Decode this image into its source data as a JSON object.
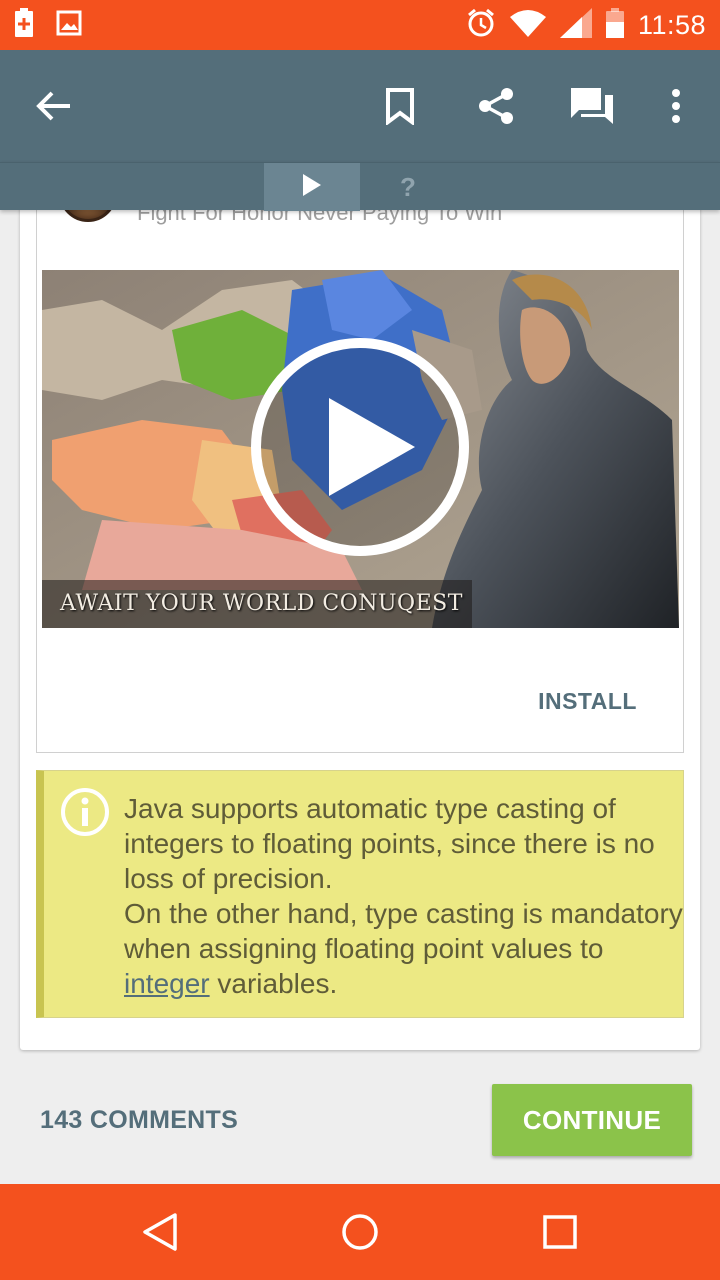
{
  "status_bar": {
    "time": "11:58",
    "icons": [
      "battery-charging-icon",
      "image-notification-icon",
      "alarm-icon",
      "wifi-icon",
      "signal-icon",
      "battery-icon"
    ],
    "color": "#f4511e"
  },
  "app_bar": {
    "icons": [
      "back-arrow-icon",
      "bookmark-icon",
      "share-icon",
      "comments-icon",
      "overflow-menu-icon"
    ],
    "color": "#546e7a"
  },
  "tabs": [
    {
      "icon": "play-icon",
      "active": true
    },
    {
      "label": "?",
      "active": false
    }
  ],
  "ad": {
    "tagline": "Fight For Honor Never Paying To Win",
    "video_caption": "AWAIT YOUR WORLD CONUQEST",
    "install_label": "INSTALL"
  },
  "tip": {
    "line1": "Java supports automatic type casting of integers to floating points, since there is no loss of precision.",
    "line2_prefix": "On the other hand, type casting is mandatory when assigning floating point values to ",
    "line2_link": "integer",
    "line2_suffix": " variables.",
    "background": "#ece984"
  },
  "footer": {
    "comments_label": "143 COMMENTS",
    "continue_label": "CONTINUE",
    "continue_color": "#8bc34a"
  },
  "nav_bar": {
    "icons": [
      "back-triangle-icon",
      "home-circle-icon",
      "recents-square-icon"
    ]
  }
}
